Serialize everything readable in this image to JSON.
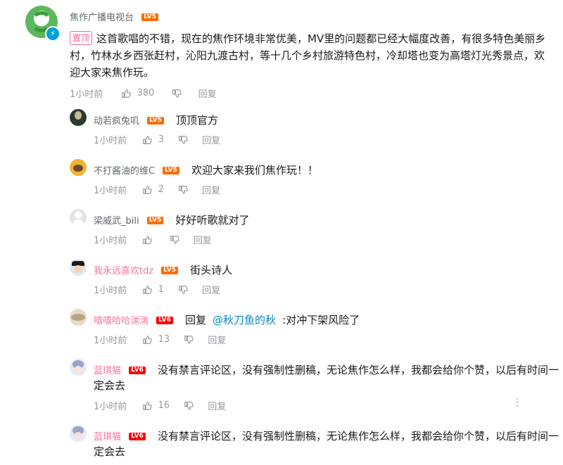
{
  "main_comment": {
    "user": "焦作广播电视台",
    "level": "LV5",
    "pin_label": "置顶",
    "text_line1": "这首歌唱的不错，现在的焦作环境非常优美，MV里的问题都已经大幅度改善，有很多特色美丽乡",
    "text_line2": "村，竹林水乡西张赶村，沁阳九渡古村，等十几个乡村旅游特色村，冷却塔也变为高塔灯光秀景点，欢",
    "text_line3": "迎大家来焦作玩。",
    "time": "1小时前",
    "likes": "380",
    "reply_label": "回复"
  },
  "replies": [
    {
      "user": "动若疯兔叽",
      "level": "LV5",
      "text": "顶顶官方",
      "time": "1小时前",
      "likes": "3",
      "reply_label": "回复"
    },
    {
      "user": "不打酱油的维C",
      "level": "LV5",
      "text": "欢迎大家来我们焦作玩！！",
      "time": "1小时前",
      "likes": "2",
      "reply_label": "回复"
    },
    {
      "user": "梁威武_bili",
      "level": "LV5",
      "text": "好好听歌就对了",
      "time": "1小时前",
      "likes": "",
      "reply_label": "回复"
    },
    {
      "user": "我永远喜欢tdz",
      "level": "LV5",
      "text": "街头诗人",
      "time": "1小时前",
      "likes": "1",
      "reply_label": "回复"
    },
    {
      "user": "嘻嘻哈哈湍湍",
      "level": "LV6",
      "reply_prefix": "回复",
      "mention": "@秋刀鱼的秋",
      "text": ":对冲下架风险了",
      "time": "1小时前",
      "likes": "13",
      "reply_label": "回复"
    },
    {
      "user": "蓝琪猫",
      "level": "LV6",
      "text_line1": "没有禁言评论区，没有强制性删稿，无论焦作怎么样，我都会给你个赞，以后有时间一",
      "text_line2": "定会去",
      "time": "1小时前",
      "likes": "16",
      "reply_label": "回复"
    },
    {
      "user": "蓝琪猫",
      "level": "LV6",
      "text_line1": "没有禁言评论区，没有强制性删稿，无论焦作怎么样，我都会给你个赞，以后有时间一",
      "text_line2": "定会去"
    }
  ],
  "more_icon": "⋮",
  "colors": {
    "pink_name": "#fb7299",
    "pin": "#ff6699",
    "mention": "#008ac5",
    "meta": "#9499a0",
    "lv5": "#ff6c00",
    "lv6": "#ff0000"
  }
}
